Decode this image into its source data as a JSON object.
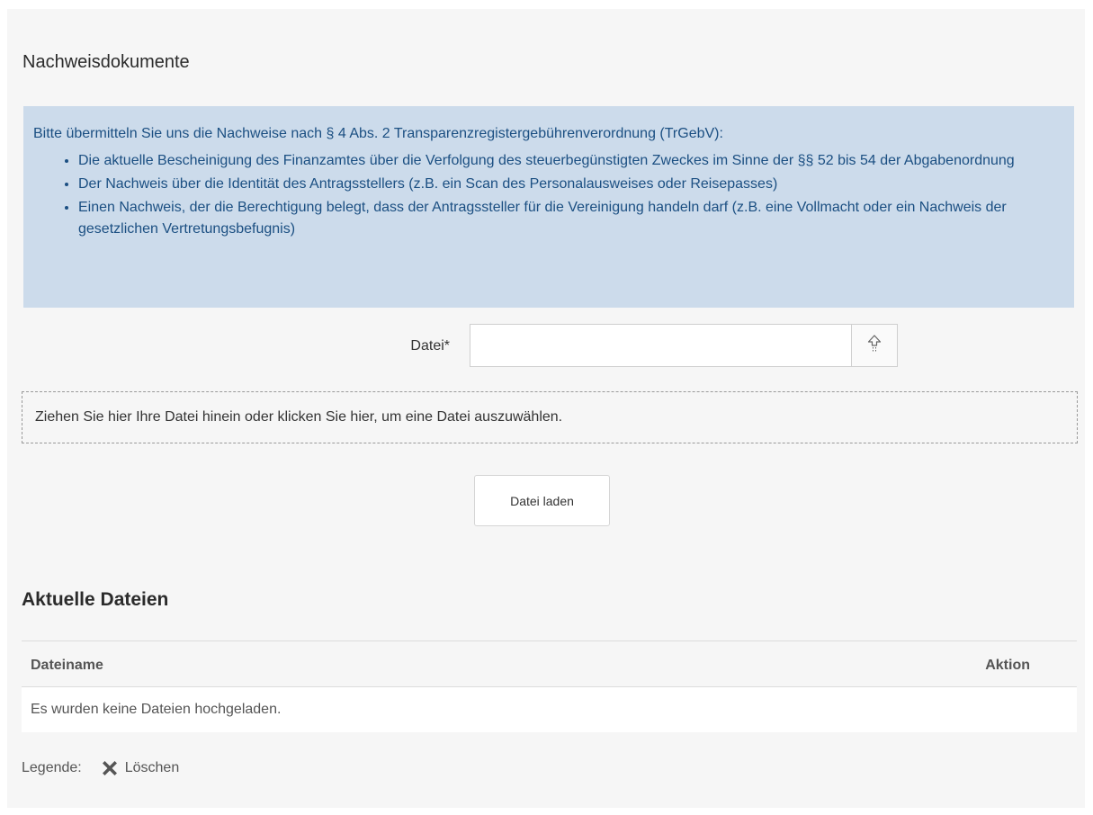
{
  "section": {
    "title": "Nachweisdokumente"
  },
  "info": {
    "intro": "Bitte übermitteln Sie uns die Nachweise nach § 4 Abs. 2 Transparenzregistergebührenverordnung (TrGebV):",
    "items": [
      "Die aktuelle Bescheinigung des Finanzamtes über die Verfolgung des steuerbegünstigten Zweckes im Sinne der §§ 52 bis 54 der Abgabenordnung",
      "Der Nachweis über die Identität des Antragsstellers (z.B. ein Scan des Personalausweises oder Reisepasses)",
      "Einen Nachweis, der die Berechtigung belegt, dass der Antragssteller für die Vereinigung handeln darf (z.B. eine Vollmacht oder ein Nachweis der gesetzlichen Vertretungsbefugnis)"
    ]
  },
  "file_field": {
    "label": "Datei*",
    "value": "",
    "upload_icon": "upload-arrow-icon"
  },
  "dropzone": {
    "text": "Ziehen Sie hier Ihre Datei hinein oder klicken Sie hier, um eine Datei auszuwählen."
  },
  "load_button": {
    "label": "Datei laden"
  },
  "files": {
    "title": "Aktuelle Dateien",
    "columns": [
      "Dateiname",
      "Aktion"
    ],
    "empty_text": "Es wurden keine Dateien hochgeladen."
  },
  "legend": {
    "label": "Legende:",
    "delete_icon": "x-icon",
    "delete_label": "Löschen"
  },
  "colors": {
    "info_background": "#ccdbeb",
    "info_text": "#1b4f82",
    "panel_background": "#f6f6f6"
  }
}
